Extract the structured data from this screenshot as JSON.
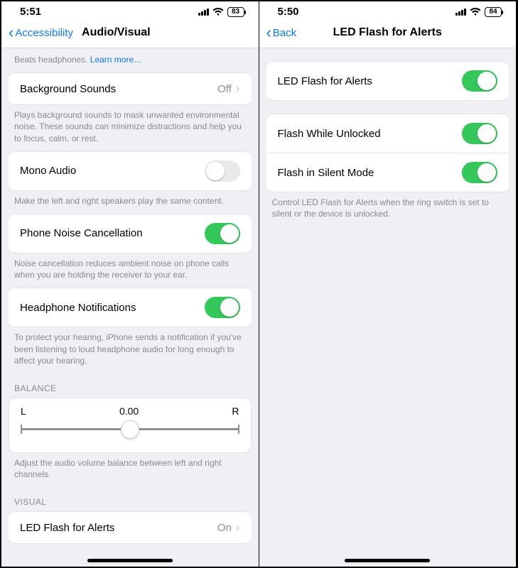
{
  "left": {
    "status": {
      "time": "5:51",
      "battery": "83"
    },
    "nav": {
      "back": "Accessibility",
      "title": "Audio/Visual"
    },
    "headphoneHint": "Beats headphones.",
    "learnMore": "Learn more...",
    "bgSounds": {
      "label": "Background Sounds",
      "value": "Off"
    },
    "bgSoundsHint": "Plays background sounds to mask unwanted environmental noise. These sounds can minimize distractions and help you to focus, calm, or rest.",
    "mono": {
      "label": "Mono Audio"
    },
    "monoHint": "Make the left and right speakers play the same content.",
    "noise": {
      "label": "Phone Noise Cancellation"
    },
    "noiseHint": "Noise cancellation reduces ambient noise on phone calls when you are holding the receiver to your ear.",
    "headphoneNotif": {
      "label": "Headphone Notifications"
    },
    "headphoneNotifHint": "To protect your hearing, iPhone sends a notification if you've been listening to loud headphone audio for long enough to affect your hearing.",
    "balanceHeader": "BALANCE",
    "balance": {
      "l": "L",
      "r": "R",
      "value": "0.00"
    },
    "balanceHint": "Adjust the audio volume balance between left and right channels.",
    "visualHeader": "VISUAL",
    "ledRow": {
      "label": "LED Flash for Alerts",
      "value": "On"
    }
  },
  "right": {
    "status": {
      "time": "5:50",
      "battery": "84"
    },
    "nav": {
      "back": "Back",
      "title": "LED Flash for Alerts"
    },
    "ledFlash": {
      "label": "LED Flash for Alerts"
    },
    "flashUnlocked": {
      "label": "Flash While Unlocked"
    },
    "flashSilent": {
      "label": "Flash in Silent Mode"
    },
    "hint": "Control LED Flash for Alerts when the ring switch is set to silent or the device is unlocked."
  }
}
